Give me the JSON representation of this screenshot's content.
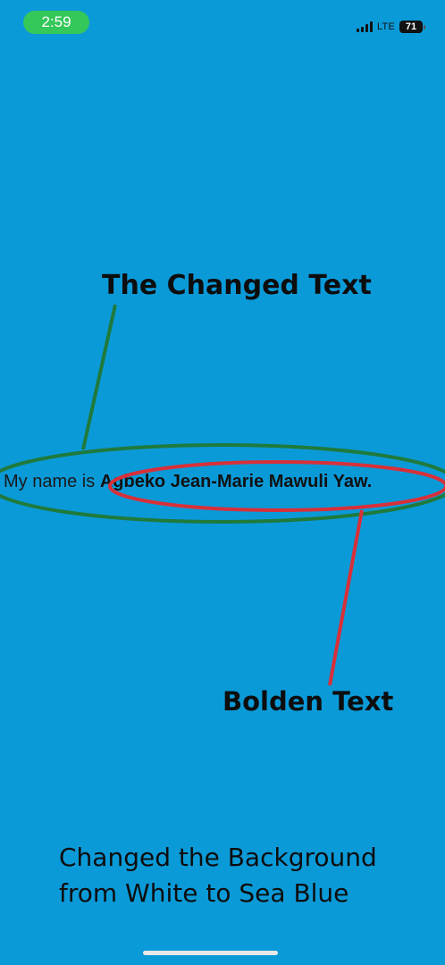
{
  "status_bar": {
    "time": "2:59",
    "network": "LTE",
    "battery_level": "71",
    "time_pill_color": "#34c759"
  },
  "annotations": {
    "changed_text_label": "The Changed Text",
    "bolden_text_label": "Bolden Text",
    "green_outline_color": "#1f7a3c",
    "red_outline_color": "#d8303a"
  },
  "content": {
    "sentence_prefix": "My name is ",
    "bold_name": "Agbeko Jean-Marie Mawuli Yaw."
  },
  "caption": {
    "line1": "Changed the Background",
    "line2": "from White to Sea Blue"
  },
  "background_color": "#0b9ad8"
}
